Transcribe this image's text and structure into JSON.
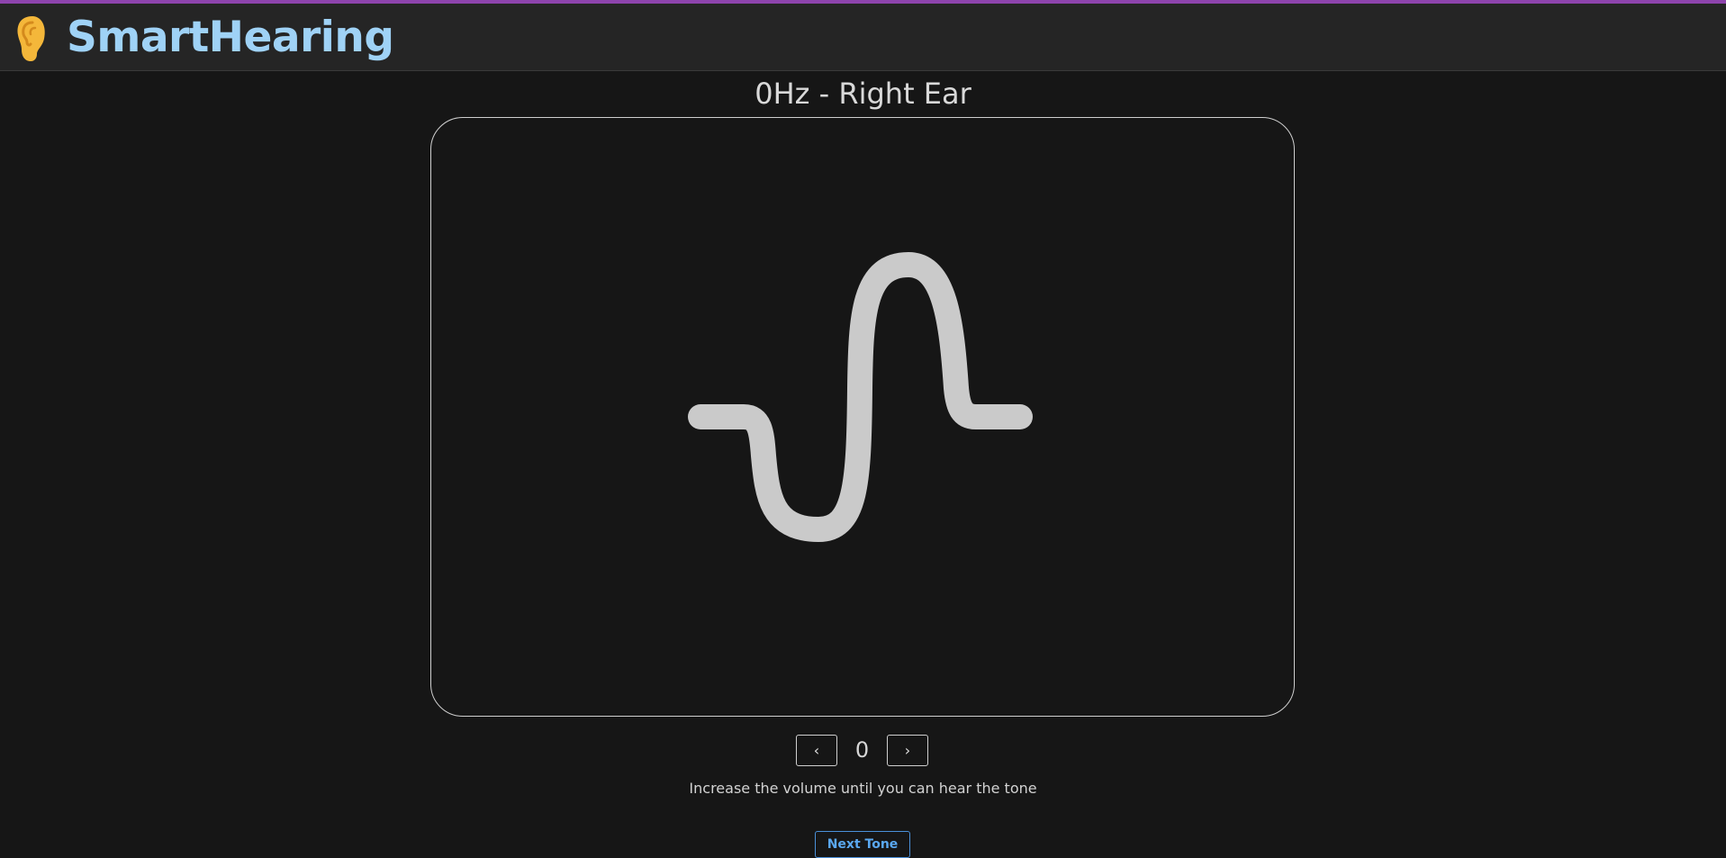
{
  "app": {
    "name": "SmartHearing",
    "icon": "ear-icon",
    "accent_color": "#8e44ad",
    "brand_color": "#9fd2f6"
  },
  "test": {
    "title": "0Hz - Right Ear",
    "wave_icon": "sine-wave-icon"
  },
  "volume": {
    "decrease_label": "‹",
    "value": "0",
    "increase_label": "›"
  },
  "hint": "Increase the volume until you can hear the tone",
  "actions": {
    "next_tone_label": "Next Tone",
    "next_tone_color": "#5aa8f0"
  }
}
